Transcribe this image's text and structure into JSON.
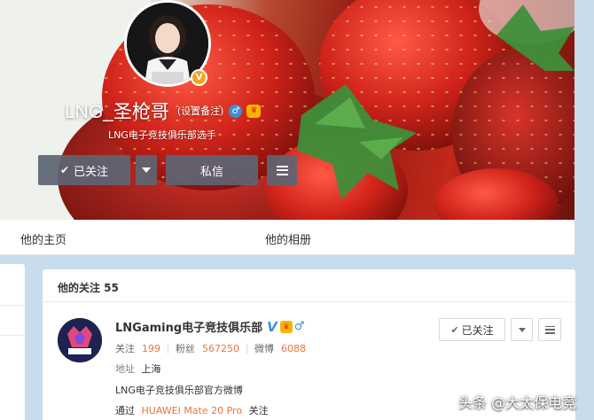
{
  "profile": {
    "username": "LNG_圣枪哥",
    "set_remark": "(设置备注)",
    "gender_icon": "male-icon",
    "verified_badge": "V",
    "vip_icon": "vip-crown-icon",
    "bio": "LNG电子竞技俱乐部选手",
    "buttons": {
      "followed": "已关注",
      "message": "私信"
    }
  },
  "tabs": [
    "他的主页",
    "他的相册"
  ],
  "follows": {
    "title": "他的关注 55",
    "items": [
      {
        "name": "LNGaming电子竞技俱乐部",
        "verified_badge": "V",
        "following_label": "关注",
        "following": "199",
        "fans_label": "粉丝",
        "fans": "567250",
        "weibo_label": "微博",
        "weibo": "6088",
        "address_label": "地址",
        "address": "上海",
        "description": "LNG电子竞技俱乐部官方微博",
        "via_prefix": "通过",
        "via_device": "HUAWEI Mate 20 Pro",
        "via_suffix": "关注",
        "followed_label": "已关注"
      }
    ]
  },
  "watermark": "头条 @大太保电竞",
  "colors": {
    "accent_orange": "#eb7340",
    "verified_gold": "#f3a51c",
    "verified_blue": "#3e8ee0",
    "dark_button": "#5d6573"
  }
}
